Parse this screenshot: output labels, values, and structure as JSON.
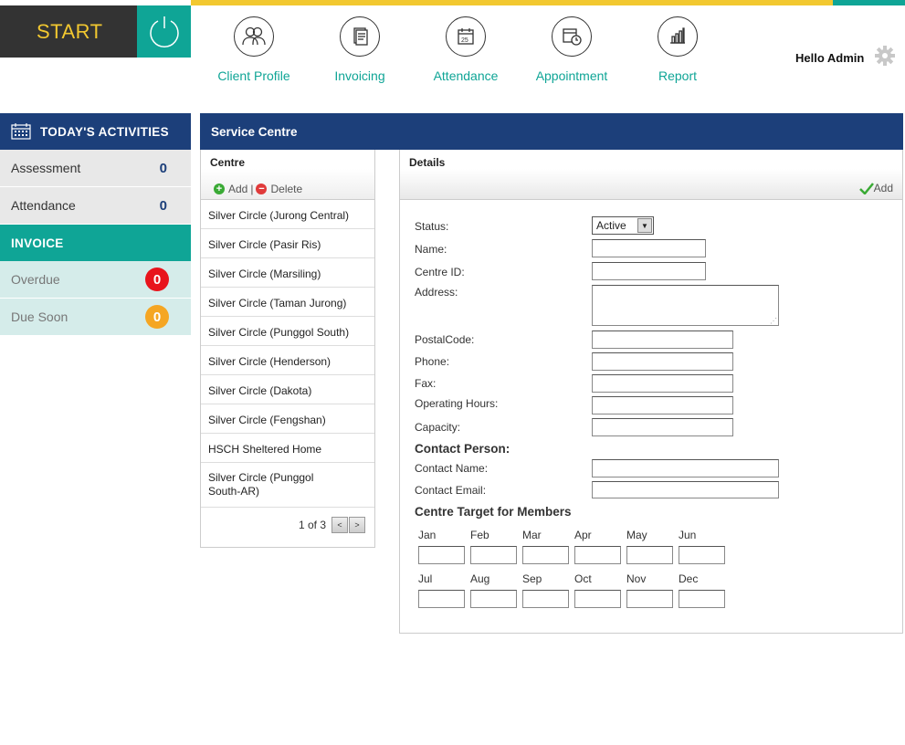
{
  "header": {
    "start_label": "START",
    "greeting": "Hello Admin",
    "nav": [
      {
        "label": "Client Profile",
        "icon": "users-icon"
      },
      {
        "label": "Invoicing",
        "icon": "document-icon"
      },
      {
        "label": "Attendance",
        "icon": "calendar-icon"
      },
      {
        "label": "Appointment",
        "icon": "appointment-clock-icon"
      },
      {
        "label": "Report",
        "icon": "bar-chart-icon"
      }
    ]
  },
  "sidebar": {
    "activities_title": "TODAY'S ACTIVITIES",
    "activities": [
      {
        "label": "Assessment",
        "count": "0"
      },
      {
        "label": "Attendance",
        "count": "0"
      }
    ],
    "invoice_title": "INVOICE",
    "invoices": [
      {
        "label": "Overdue",
        "count": "0",
        "color": "#e8141c"
      },
      {
        "label": "Due Soon",
        "count": "0",
        "color": "#f5a623"
      }
    ]
  },
  "main": {
    "title": "Service Centre",
    "centre": {
      "title": "Centre",
      "add_label": "Add",
      "separator": "|",
      "delete_label": "Delete",
      "items": [
        "Silver Circle (Jurong Central)",
        "Silver Circle (Pasir Ris)",
        "Silver Circle (Marsiling)",
        "Silver Circle (Taman Jurong)",
        "Silver Circle (Punggol South)",
        "Silver Circle (Henderson)",
        "Silver Circle (Dakota)",
        "Silver Circle (Fengshan)",
        "HSCH Sheltered Home",
        "Silver Circle (Punggol South-AR)"
      ],
      "pager_text": "1 of 3",
      "prev": "<",
      "next": ">"
    },
    "details": {
      "title": "Details",
      "add_label": "Add",
      "status_label": "Status:",
      "status_value": "Active",
      "name_label": "Name:",
      "centre_id_label": "Centre ID:",
      "address_label": "Address:",
      "postal_label": "PostalCode:",
      "phone_label": "Phone:",
      "fax_label": "Fax:",
      "hours_label": "Operating Hours:",
      "capacity_label": "Capacity:",
      "contact_section": "Contact Person:",
      "contact_name_label": "Contact Name:",
      "contact_email_label": "Contact Email:",
      "target_section": "Centre Target for Members",
      "months": [
        "Jan",
        "Feb",
        "Mar",
        "Apr",
        "May",
        "Jun",
        "Jul",
        "Aug",
        "Sep",
        "Oct",
        "Nov",
        "Dec"
      ]
    }
  },
  "colors": {
    "navy": "#1c3f7a",
    "teal": "#0fa596",
    "yellow": "#f2c830"
  }
}
